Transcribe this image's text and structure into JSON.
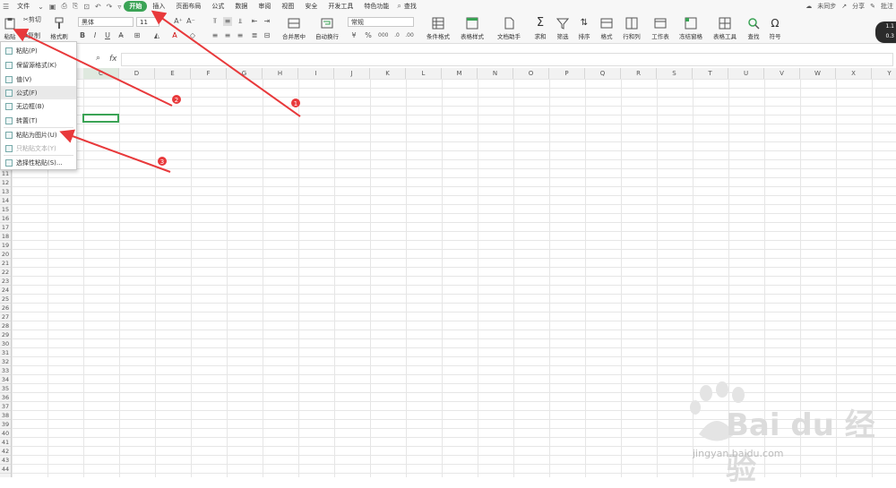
{
  "menubar": {
    "file": "文件",
    "tabs": [
      "开始",
      "插入",
      "页面布局",
      "公式",
      "数据",
      "审阅",
      "视图",
      "安全",
      "开发工具",
      "特色功能"
    ],
    "search": "查找",
    "sync": "未同步",
    "share": "分享",
    "comment": "批注"
  },
  "ribbon": {
    "paste": "粘贴",
    "cut": "剪切",
    "copy": "复制",
    "format_painter": "格式刷",
    "font": "黑体",
    "size": "11",
    "merge": "合并居中",
    "wrap": "自动换行",
    "number_format": "常规",
    "cond_format": "条件格式",
    "table_style": "表格样式",
    "doc_helper": "文档助手",
    "sum": "求和",
    "filter": "筛选",
    "sort": "排序",
    "format": "格式",
    "row_col": "行和列",
    "sheet": "工作表",
    "freeze": "冻结窗格",
    "table_tools": "表格工具",
    "find": "查找",
    "symbol": "符号"
  },
  "badge": {
    "line1": "1.1",
    "line2": "0.3"
  },
  "formula": {
    "fx": "fx"
  },
  "columns": [
    "C",
    "D",
    "E",
    "F",
    "G",
    "H",
    "I",
    "J",
    "K",
    "L",
    "M",
    "N",
    "O",
    "P",
    "Q",
    "R",
    "S",
    "T",
    "U",
    "V",
    "W",
    "X",
    "Y"
  ],
  "rows": [
    "11",
    "12",
    "13",
    "14",
    "15",
    "16",
    "17",
    "18",
    "19",
    "20",
    "21",
    "22",
    "23",
    "24",
    "25",
    "26",
    "27",
    "28",
    "29",
    "30",
    "31",
    "32",
    "33",
    "34",
    "35",
    "36",
    "37",
    "38",
    "39",
    "40",
    "41",
    "42",
    "43",
    "44"
  ],
  "dropdown": {
    "items": [
      {
        "label": "粘贴(P)",
        "disabled": false
      },
      {
        "label": "保留源格式(K)",
        "disabled": false
      },
      {
        "label": "值(V)",
        "disabled": false
      },
      {
        "label": "公式(F)",
        "disabled": false
      },
      {
        "label": "无边框(B)",
        "disabled": false
      },
      {
        "label": "转置(T)",
        "disabled": false
      },
      {
        "label": "粘贴为图片(U)",
        "disabled": false
      },
      {
        "label": "只粘贴文本(Y)",
        "disabled": true
      },
      {
        "label": "选择性粘贴(S)...",
        "disabled": false
      }
    ]
  },
  "annotations": {
    "n1": "1",
    "n2": "2",
    "n3": "3",
    "color": "#e8393b"
  },
  "watermark": {
    "main": "Bai du 经验",
    "sub": "jingyan.baidu.com"
  },
  "colors": {
    "accent": "#3aa355",
    "annotation": "#e8393b"
  }
}
